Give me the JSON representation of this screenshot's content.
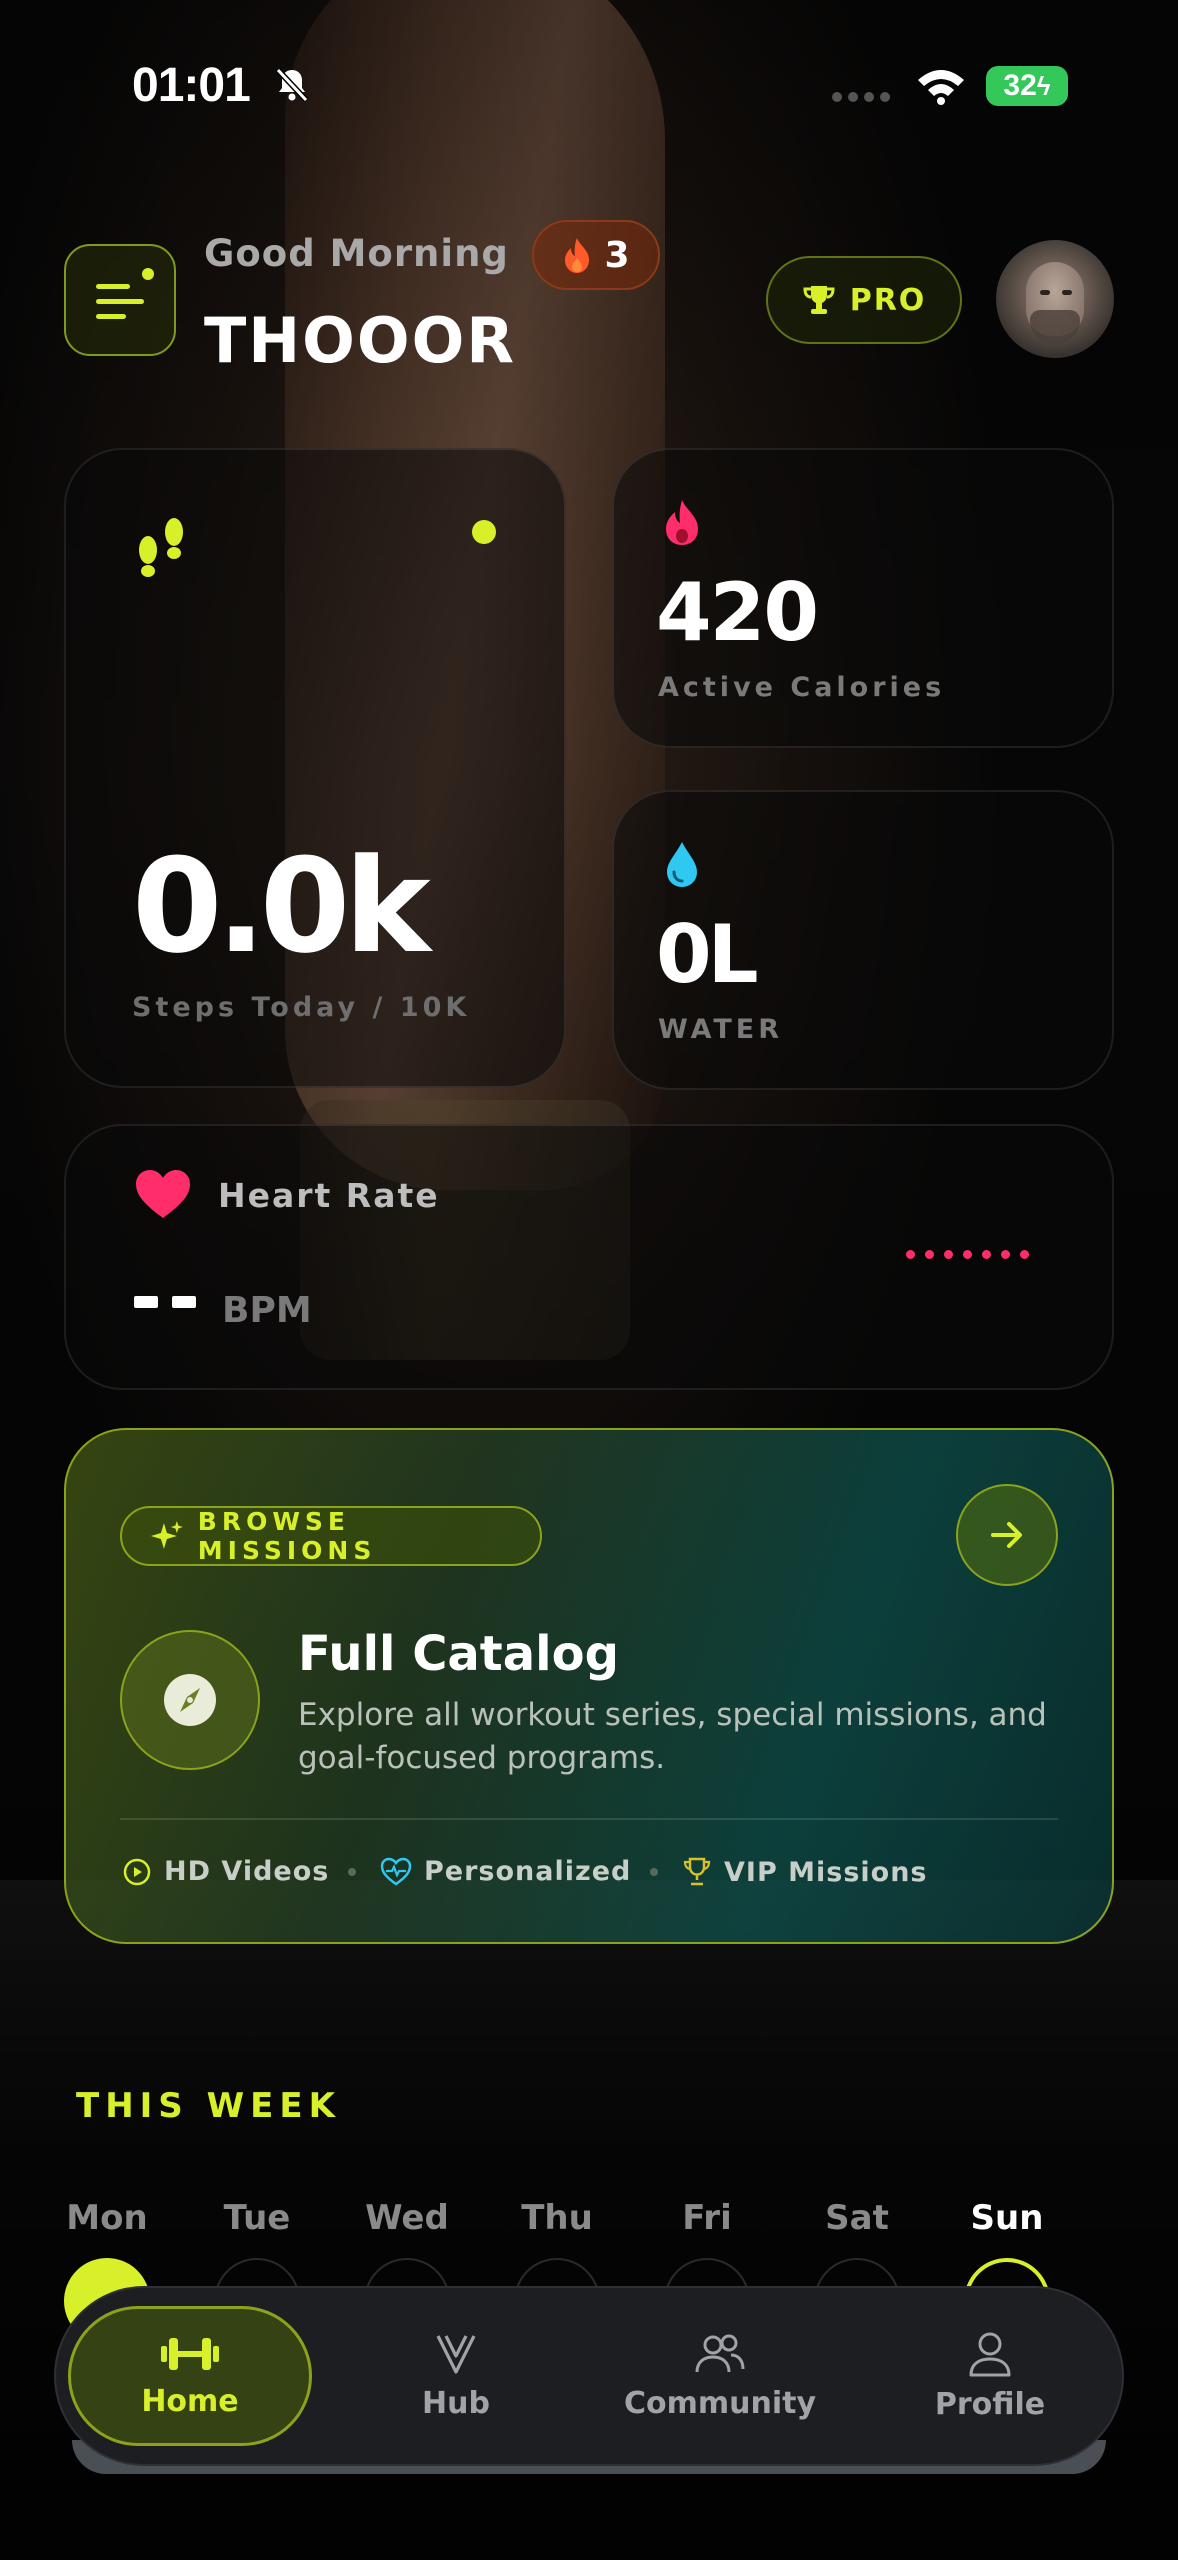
{
  "status": {
    "time": "01:01",
    "battery": "32"
  },
  "header": {
    "greeting": "Good Morning",
    "username": "THOOOR",
    "streak": "3",
    "pro_label": "PRO"
  },
  "steps": {
    "value": "0.0k",
    "label": "Steps Today / 10K"
  },
  "calories": {
    "value": "420",
    "label": "Active Calories"
  },
  "water": {
    "value": "0L",
    "label": "WATER"
  },
  "heart": {
    "title": "Heart Rate",
    "unit": "BPM"
  },
  "missions": {
    "pill": "BROWSE MISSIONS",
    "title": "Full Catalog",
    "description": "Explore all workout series, special missions, and goal-focused programs.",
    "features": [
      "HD Videos",
      "Personalized",
      "VIP Missions"
    ]
  },
  "week": {
    "title": "THIS WEEK",
    "days": [
      "Mon",
      "Tue",
      "Wed",
      "Thu",
      "Fri",
      "Sat",
      "Sun"
    ],
    "completed": [
      "Mon"
    ],
    "today": "Sun"
  },
  "tabs": [
    {
      "label": "Home",
      "icon": "dumbbell-icon",
      "active": true
    },
    {
      "label": "Hub",
      "icon": "hub-logo-icon"
    },
    {
      "label": "Community",
      "icon": "people-icon"
    },
    {
      "label": "Profile",
      "icon": "person-icon"
    }
  ],
  "colors": {
    "accent": "#d8f02a",
    "heart": "#ff2d6a",
    "water": "#2ec8f0",
    "flame": "#ff5a2a"
  }
}
